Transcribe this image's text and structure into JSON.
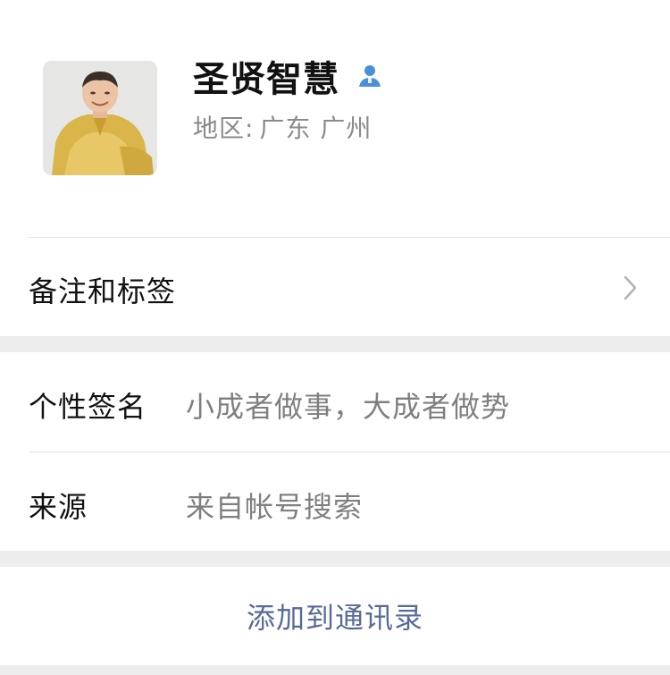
{
  "profile": {
    "name": "圣贤智慧",
    "region_label": "地区:",
    "region_value": "广东 广州",
    "verified_icon": "person-icon",
    "accent_color": "#4a90d9"
  },
  "remarks_row": {
    "label": "备注和标签",
    "chevron_icon": "chevron-right-icon"
  },
  "signature_row": {
    "label": "个性签名",
    "value": "小成者做事，大成者做势"
  },
  "source_row": {
    "label": "来源",
    "value": "来自帐号搜索"
  },
  "action": {
    "add_label": "添加到通讯录",
    "color": "#576b95"
  }
}
